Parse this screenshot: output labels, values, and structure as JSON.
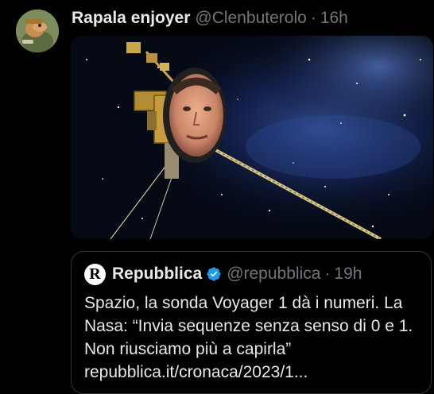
{
  "tweet": {
    "display_name": "Rapala enjoyer",
    "handle": "@Clenbuterolo",
    "separator": "·",
    "time": "16h",
    "media_description_icon": "voyager-probe-image"
  },
  "quoted_tweet": {
    "logo_letter": "R",
    "display_name": "Repubblica",
    "verified_icon": "verified-badge-icon",
    "handle": "@repubblica",
    "separator": "·",
    "time": "19h",
    "text": "Spazio, la sonda Voyager 1 dà i numeri. La Nasa: “Invia sequenze senza senso di 0 e 1. Non riusciamo più a capirla” repubblica.it/cronaca/2023/1..."
  },
  "colors": {
    "background": "#000000",
    "text_primary": "#e7e9ea",
    "text_secondary": "#71767b",
    "border": "#2f3336",
    "verified": "#1d9bf0"
  }
}
